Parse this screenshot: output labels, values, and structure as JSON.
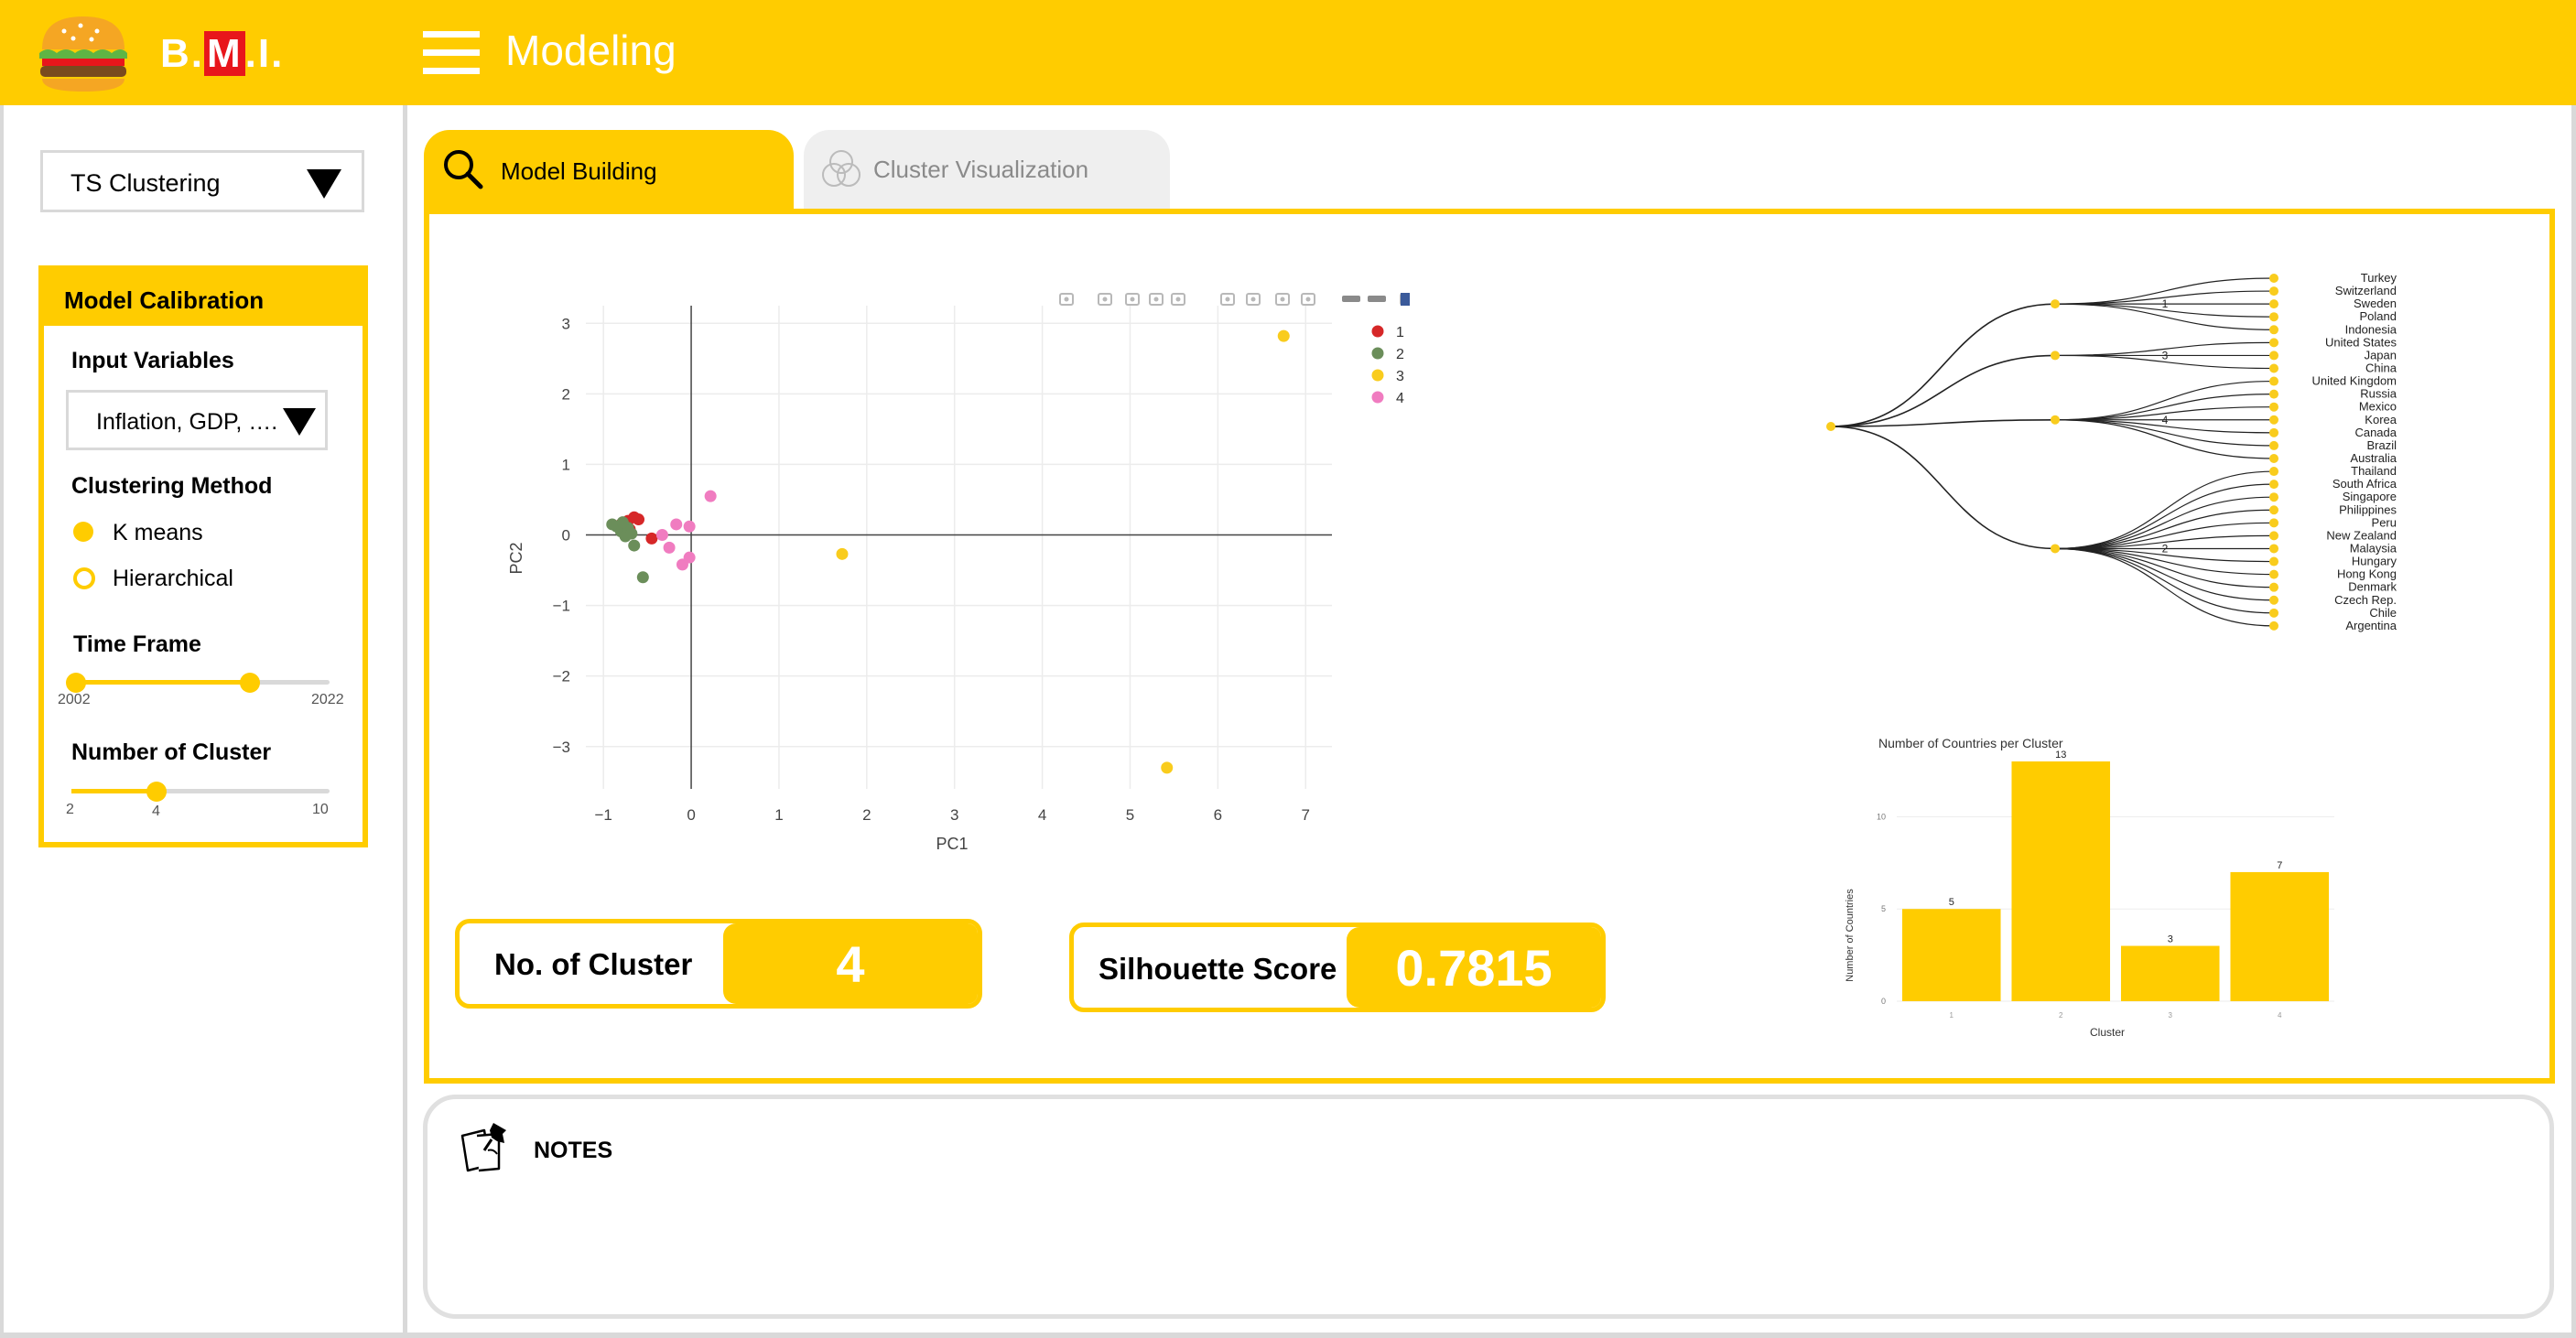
{
  "header": {
    "logo_text": "B.M.I.",
    "logo_letters": [
      "B.",
      "M",
      ".I."
    ],
    "title": "Modeling",
    "brand_color": "#FFCC00",
    "logo_accent_color": "#E8161B"
  },
  "sidebar": {
    "module_select": {
      "value": "TS Clustering"
    },
    "calibration": {
      "title": "Model Calibration",
      "input_variables": {
        "label": "Input Variables",
        "value": "Inflation, GDP, …."
      },
      "clustering_method": {
        "label": "Clustering Method",
        "options": [
          {
            "label": "K means",
            "selected": true
          },
          {
            "label": "Hierarchical",
            "selected": false
          }
        ]
      },
      "time_frame": {
        "label": "Time Frame",
        "min_label": "2002",
        "max_label": "2022",
        "min": 2002,
        "max": 2022,
        "selected_start": 2002,
        "selected_end": 2017
      },
      "num_clusters": {
        "label": "Number of Cluster",
        "min_label": "2",
        "max_label": "10",
        "value_label": "4",
        "min": 2,
        "max": 10,
        "value": 4
      }
    }
  },
  "tabs": [
    {
      "label": "Model Building",
      "icon": "search-icon",
      "active": true
    },
    {
      "label": "Cluster Visualization",
      "icon": "venn-icon",
      "active": false
    }
  ],
  "scatter": {
    "xlabel": "PC1",
    "ylabel": "PC2",
    "xlim": [
      -1.2,
      7.3
    ],
    "ylim": [
      -3.6,
      3.25
    ],
    "x_ticks": [
      -1,
      0,
      1,
      2,
      3,
      4,
      5,
      6,
      7
    ],
    "y_ticks": [
      -3,
      -2,
      -1,
      0,
      1,
      2,
      3
    ],
    "toolbar_icons": [
      "camera-icon",
      "zoom-icon",
      "pan-icon",
      "box-select-icon",
      "lasso-icon",
      "zoom-in-icon",
      "zoom-out-icon",
      "autoscale-icon",
      "home-icon",
      "spike-icon",
      "hover-closest-icon",
      "hover-compare-icon",
      "plotly-logo-icon"
    ]
  },
  "kpis": {
    "clusters": {
      "label": "No. of Cluster",
      "value": "4"
    },
    "silhouette": {
      "label": "Silhouette Score",
      "value": "0.7815"
    }
  },
  "dendrogram": {
    "branch_labels": [
      "1",
      "3",
      "4",
      "2"
    ],
    "leaves": [
      "Turkey",
      "Switzerland",
      "Sweden",
      "Poland",
      "Indonesia",
      "United States",
      "Japan",
      "China",
      "United Kingdom",
      "Russia",
      "Mexico",
      "Korea",
      "Canada",
      "Brazil",
      "Australia",
      "Thailand",
      "South Africa",
      "Singapore",
      "Philippines",
      "Peru",
      "New Zealand",
      "Malaysia",
      "Hungary",
      "Hong Kong",
      "Denmark",
      "Czech Rep.",
      "Chile",
      "Argentina"
    ]
  },
  "notes": {
    "title": "NOTES"
  },
  "chart_data": [
    {
      "type": "scatter",
      "xlabel": "PC1",
      "ylabel": "PC2",
      "xlim": [
        -1.2,
        7.3
      ],
      "ylim": [
        -3.6,
        3.25
      ],
      "legend_position": "top-right",
      "series": [
        {
          "name": "1",
          "color": "#D62728",
          "points": [
            [
              -0.72,
              0.2
            ],
            [
              -0.65,
              0.25
            ],
            [
              -0.6,
              0.22
            ],
            [
              -0.7,
              0.08
            ],
            [
              -0.45,
              -0.05
            ],
            [
              -0.8,
              0.15
            ]
          ]
        },
        {
          "name": "2",
          "color": "#6B8E5A",
          "points": [
            [
              -0.85,
              0.12
            ],
            [
              -0.8,
              0.05
            ],
            [
              -0.72,
              0.1
            ],
            [
              -0.75,
              -0.02
            ],
            [
              -0.68,
              0.02
            ],
            [
              -0.65,
              -0.15
            ],
            [
              -0.55,
              -0.6
            ],
            [
              -0.9,
              0.15
            ],
            [
              -0.78,
              0.18
            ]
          ]
        },
        {
          "name": "3",
          "color": "#F9CC1D",
          "points": [
            [
              6.75,
              2.82
            ],
            [
              1.72,
              -0.27
            ],
            [
              5.42,
              -3.3
            ]
          ]
        },
        {
          "name": "4",
          "color": "#F07CC0",
          "points": [
            [
              0.22,
              0.55
            ],
            [
              -0.17,
              0.15
            ],
            [
              -0.02,
              0.12
            ],
            [
              -0.33,
              0.0
            ],
            [
              -0.25,
              -0.18
            ],
            [
              -0.1,
              -0.42
            ],
            [
              -0.02,
              -0.32
            ]
          ]
        }
      ]
    },
    {
      "type": "bar",
      "title": "Number of Countries per Cluster",
      "xlabel": "Cluster",
      "ylabel": "Number of Countries",
      "categories": [
        "1",
        "2",
        "3",
        "4"
      ],
      "values": [
        5,
        13,
        3,
        7
      ],
      "ylim": [
        0,
        13
      ],
      "y_ticks": [
        0,
        5,
        10
      ],
      "color": "#FFCC00"
    }
  ]
}
